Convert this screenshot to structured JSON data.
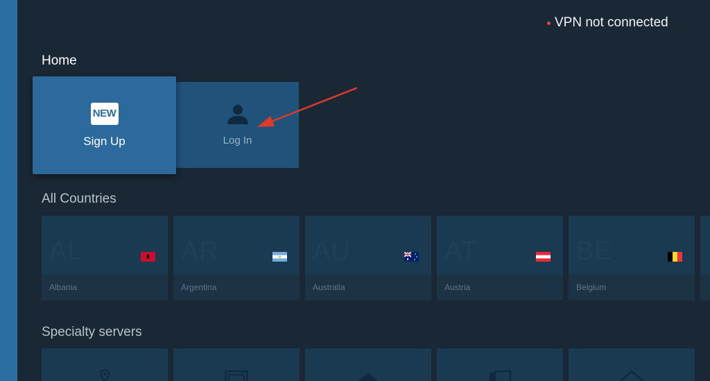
{
  "header": {
    "vpn_status": "VPN not connected"
  },
  "home": {
    "title": "Home",
    "signup_badge": "NEW",
    "signup_label": "Sign Up",
    "login_label": "Log In"
  },
  "countries": {
    "title": "All Countries",
    "items": [
      {
        "code": "AL",
        "name": "Albania"
      },
      {
        "code": "AR",
        "name": "Argentina"
      },
      {
        "code": "AU",
        "name": "Australia"
      },
      {
        "code": "AT",
        "name": "Austria"
      },
      {
        "code": "BE",
        "name": "Belgium"
      }
    ]
  },
  "specialty": {
    "title": "Specialty servers"
  },
  "colors": {
    "background": "#1a2734",
    "accent": "#2b6fa3",
    "status_dot": "#e5453a",
    "annotation_arrow": "#e03a28"
  }
}
